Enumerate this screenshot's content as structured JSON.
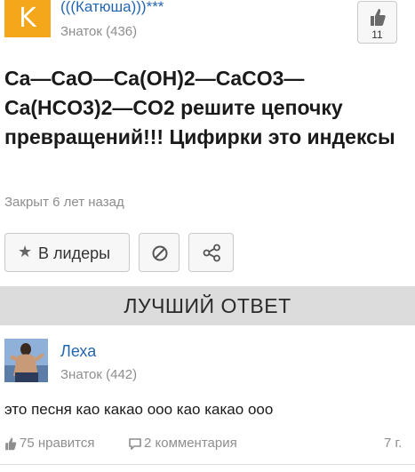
{
  "question_author": {
    "avatar_letter": "K",
    "name": "(((Катюша)))***",
    "rank": "Знаток (436)"
  },
  "like": {
    "count": "11"
  },
  "question": {
    "title": "Ca—CaO—Ca(OH)2—CaCO3—Ca(HCO3)2—CO2 решите цепочку превращений!!! Цифирки это индексы",
    "status": "Закрыт 6 лет назад"
  },
  "actions": {
    "leaders_label": "В лидеры"
  },
  "best_answer": {
    "header": "ЛУЧШИЙ ОТВЕТ",
    "author": "Леха",
    "rank": "Знаток (442)",
    "text": "это песня као какао ооо као какао ооо",
    "likes": "75 нравится",
    "comments": "2 комментария",
    "time": "7 г."
  },
  "colors": {
    "avatar_bg": "#f5a71c",
    "link": "#2566b2",
    "muted": "#8e8e8e",
    "section_bg": "#dcdcdc"
  }
}
